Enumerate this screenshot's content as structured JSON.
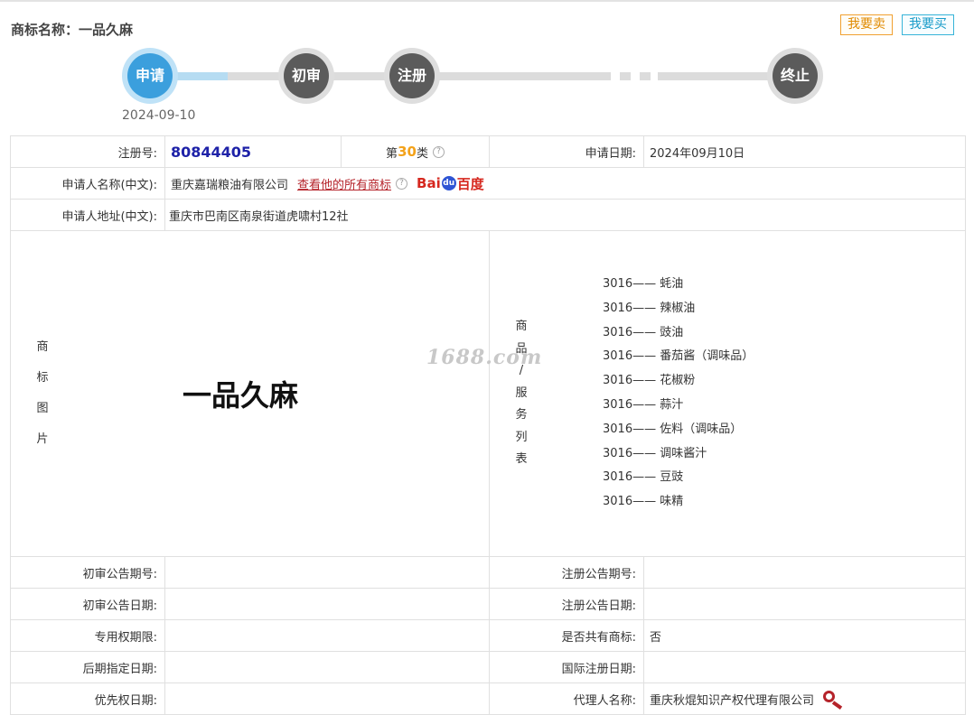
{
  "header": {
    "title_label": "商标名称：",
    "title_value": "一品久麻",
    "sell_button": "我要卖",
    "buy_button": "我要买"
  },
  "progress": {
    "steps": [
      {
        "label": "申请",
        "active": true
      },
      {
        "label": "初审",
        "active": false
      },
      {
        "label": "注册",
        "active": false
      },
      {
        "label": "终止",
        "active": false
      }
    ],
    "date": "2024-09-10"
  },
  "details": {
    "reg_no_label": "注册号:",
    "reg_no": "80844405",
    "class_prefix": "第",
    "class_num": "30",
    "class_suffix": "类",
    "help_mark": "?",
    "apply_date_label": "申请日期:",
    "apply_date": "2024年09月10日",
    "applicant_label": "申请人名称(中文):",
    "applicant": "重庆嘉瑞粮油有限公司",
    "all_marks_link": "查看他的所有商标",
    "baidu_left": "Bai",
    "baidu_paw": "du",
    "baidu_right": "百度",
    "address_label": "申请人地址(中文):",
    "address": "重庆市巴南区南泉街道虎啸村12社"
  },
  "image_section": {
    "label_chars": [
      "商",
      "标",
      "图",
      "片"
    ],
    "brand_text": "一品久麻",
    "goods_label_chars": [
      "商",
      "品",
      "/",
      "服",
      "务",
      "列",
      "表"
    ],
    "goods": [
      "3016—— 蚝油",
      "3016—— 辣椒油",
      "3016—— 豉油",
      "3016—— 番茄酱（调味品）",
      "3016—— 花椒粉",
      "3016—— 蒜汁",
      "3016—— 佐料（调味品）",
      "3016—— 调味酱汁",
      "3016—— 豆豉",
      "3016—— 味精"
    ],
    "watermark": "1688.com"
  },
  "bottom_rows": [
    {
      "l_label": "初审公告期号:",
      "l_value": "",
      "r_label": "注册公告期号:",
      "r_value": ""
    },
    {
      "l_label": "初审公告日期:",
      "l_value": "",
      "r_label": "注册公告日期:",
      "r_value": ""
    },
    {
      "l_label": "专用权期限:",
      "l_value": "",
      "r_label": "是否共有商标:",
      "r_value": "否"
    },
    {
      "l_label": "后期指定日期:",
      "l_value": "",
      "r_label": "国际注册日期:",
      "r_value": ""
    },
    {
      "l_label": "优先权日期:",
      "l_value": "",
      "r_label": "代理人名称:",
      "r_value": "重庆秋焜知识产权代理有限公司"
    }
  ],
  "colors": {
    "active_step": "#3b9fdd",
    "inactive_step": "#5b5b5b",
    "reg_no": "#1e22a8",
    "class_num": "#f3a21a",
    "link": "#b5232a"
  },
  "icons": {
    "help": "question-circle-icon",
    "search": "magnifier-icon",
    "baidu": "baidu-logo"
  }
}
